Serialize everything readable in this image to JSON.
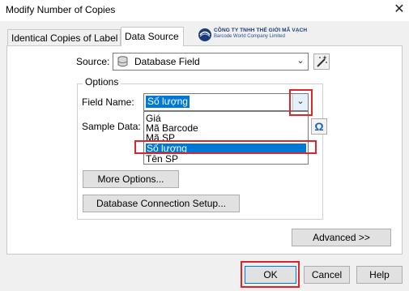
{
  "window": {
    "title": "Modify Number of Copies",
    "close_glyph": "✕"
  },
  "tabs": [
    {
      "label": "Identical Copies of Label",
      "active": false
    },
    {
      "label": "Data Source",
      "active": true
    }
  ],
  "logo": {
    "line1": "CÔNG TY TNHH THẾ GIỚI MÃ VẠCH",
    "line2": "Barcode World Company Limited"
  },
  "source": {
    "label": "Source:",
    "value": "Database Field",
    "icon": "database-icon",
    "wizard_icon": "magic-wand-icon"
  },
  "options": {
    "legend": "Options",
    "field_name_label": "Field Name:",
    "field_name_value": "Số lượng",
    "sample_data_label": "Sample Data:",
    "dropdown_items": [
      "Giá",
      "Mã Barcode",
      "Mã SP",
      "Số lượng",
      "Tên SP"
    ],
    "selected_index": 3,
    "omega_glyph": "Ω",
    "more_options_label": "More Options...",
    "db_connection_label": "Database Connection Setup..."
  },
  "buttons": {
    "advanced": "Advanced >>",
    "ok": "OK",
    "cancel": "Cancel",
    "help": "Help"
  },
  "colors": {
    "highlight": "#0078d7",
    "annotation_red": "#e0242b"
  }
}
